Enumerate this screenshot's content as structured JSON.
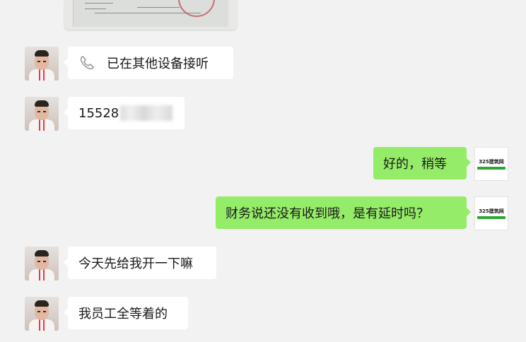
{
  "messages": {
    "call_status": "已在其他设备接听",
    "phone_number": "15528",
    "reply_ok": "好的，稍等",
    "reply_finance": "财务说还没有收到哦，是有延时吗？",
    "msg_pay_first": "今天先给我开一下嘛",
    "msg_staff_waiting": "我员工全等着的"
  },
  "self_avatar": {
    "logo_text": "325建筑网"
  },
  "colors": {
    "background": "#f2f2f2",
    "incoming_bubble": "#ffffff",
    "outgoing_bubble": "#95ec69"
  },
  "icons": {
    "call": "phone-icon"
  }
}
